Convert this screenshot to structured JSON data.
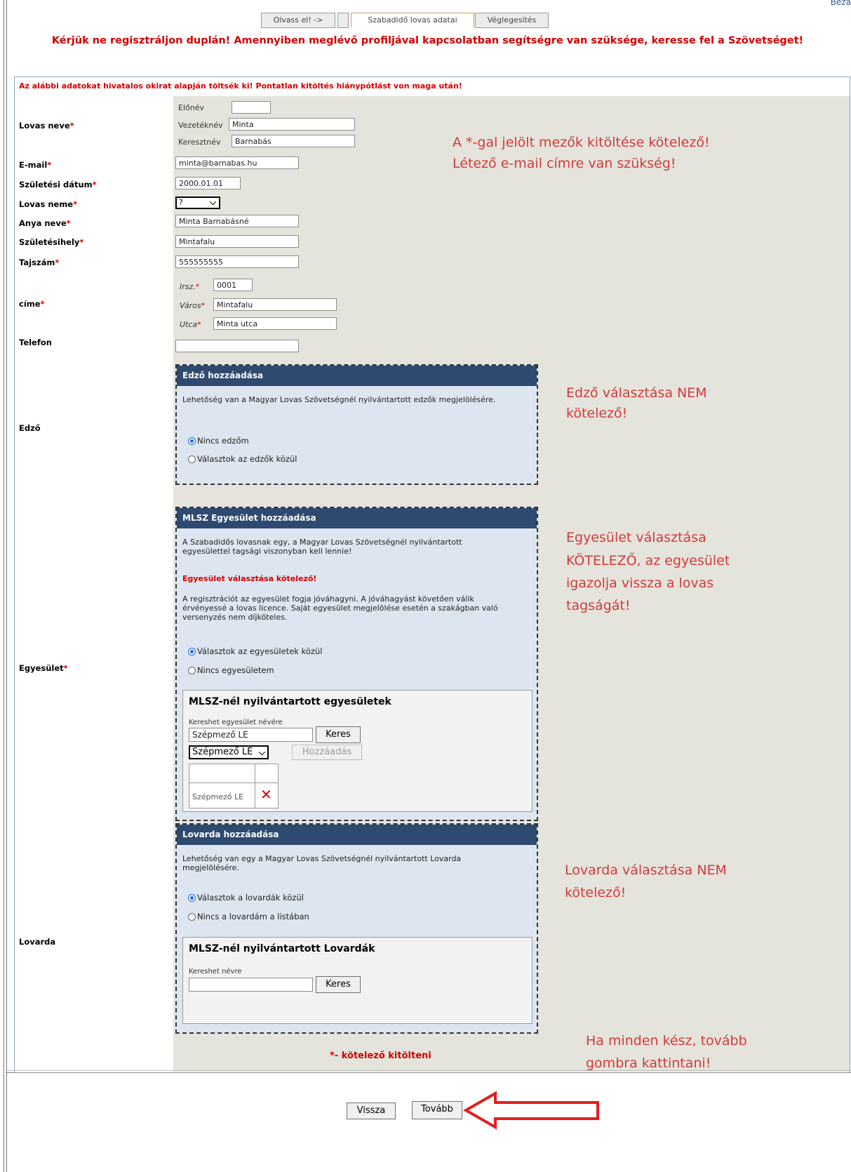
{
  "corner_text": "Beza",
  "tabs": [
    "Olvass el! ->",
    "",
    "Szabadidő lovas adatai",
    "Véglegesítés"
  ],
  "warning_main": "Kérjük ne regisztráljon duplán! Amennyiben meglévő profiljával kapcsolatban segítségre van szüksége, keresse fel a Szövetséget!",
  "warning_official": "Az alábbi adatokat hivatalos okirat alapján töltsék ki! Pontatlan kitöltés hiánypótlást von maga után!",
  "req_mark": "*",
  "labels": {
    "name": "Lovas neve",
    "email": "E-mail",
    "birth_date": "Születési dátum",
    "gender": "Lovas neme",
    "mother": "Anya neve",
    "birthplace": "Születésihely",
    "taj": "Tajszám",
    "address": "címe",
    "phone": "Telefon",
    "coach": "Edző",
    "club": "Egyesület",
    "arena": "Lovarda"
  },
  "sublabels": {
    "prefix": "Előnév",
    "surname": "Vezetéknév",
    "firstname": "Keresztnév",
    "zip": "Irsz.",
    "city": "Város",
    "street": "Utca"
  },
  "values": {
    "prefix": "",
    "surname": "Minta",
    "firstname": "Barnabás",
    "email": "minta@barnabas.hu",
    "birth_date": "2000.01.01",
    "gender": "?",
    "mother": "Minta Barnabásné",
    "birthplace": "Mintafalu",
    "taj": "555555555",
    "zip": "0001",
    "city": "Mintafalu",
    "street": "Minta utca",
    "phone": ""
  },
  "coach_panel": {
    "title": "Edző hozzáadása",
    "text": "Lehetőség van a Magyar Lovas Szövetségnél nyilvántartott edzők megjelölésére.",
    "options": [
      "Nincs edzőm",
      "Választok az edzők közül"
    ],
    "selected": 0
  },
  "club_panel": {
    "title": "MLSZ Egyesület hozzáadása",
    "text1": "A Szabadidős lovasnak egy, a Magyar Lovas Szövetségnél nyilvántartott egyesülettel tagsági viszonyban kell lennie!",
    "required_note": "Egyesület választása kötelező!",
    "text2": "A regisztrációt az egyesület fogja jóváhagyni. A jóváhagyást követően válik érvényessé a lovas licence. Saját egyesület megjelölése esetén a szakágban való versenyzés nem díjköteles.",
    "options": [
      "Választok az egyesületek közül",
      "Nincs egyesületem"
    ],
    "selected": 0,
    "box_title": "MLSZ-nél nyilvántartott egyesületek",
    "search_label": "Kereshet egyesület névére",
    "search_value": "Szépmező LE",
    "search_button": "Keres",
    "select_value": "Szépmező LE",
    "add_button": "Hozzáadás",
    "selected_item": "Szépmező LE"
  },
  "arena_panel": {
    "title": "Lovarda hozzáadása",
    "text": "Lehetőség van egy a Magyar Lovas Szövetségnél nyilvántartott Lovarda megjelölésére.",
    "options": [
      "Választok a lovardák közül",
      "Nincs a lovardám a listában"
    ],
    "selected": 0,
    "box_title": "MLSZ-nél nyilvántartott Lovardák",
    "search_label": "Kereshet névre",
    "search_value": "",
    "search_button": "Keres"
  },
  "annotations": {
    "required_fields": "A *-gal jelölt mezők kitöltése kötelező!",
    "email_note": "Létező e-mail címre van szükség!",
    "coach_note": [
      "Edző választása NEM",
      "kötelező!"
    ],
    "club_note": [
      "Egyesület választása",
      "KÖTELEZŐ, az egyesület",
      "igazolja vissza a lovas",
      "tagságát!"
    ],
    "arena_note": [
      "Lovarda választása NEM",
      "kötelező!"
    ],
    "done_note": [
      "Ha minden kész, tovább",
      "gombra kattintani!"
    ]
  },
  "bottom_required": "*- kötelező kitölteni",
  "buttons": {
    "back": "Vissza",
    "next": "Tovább"
  },
  "colors": {
    "warning_red": "#d10000",
    "annotation_red": "#d23a3a",
    "panel_header": "#2f4a70",
    "label_bg": "#e4e4dc",
    "arrow_red": "#e02020"
  }
}
